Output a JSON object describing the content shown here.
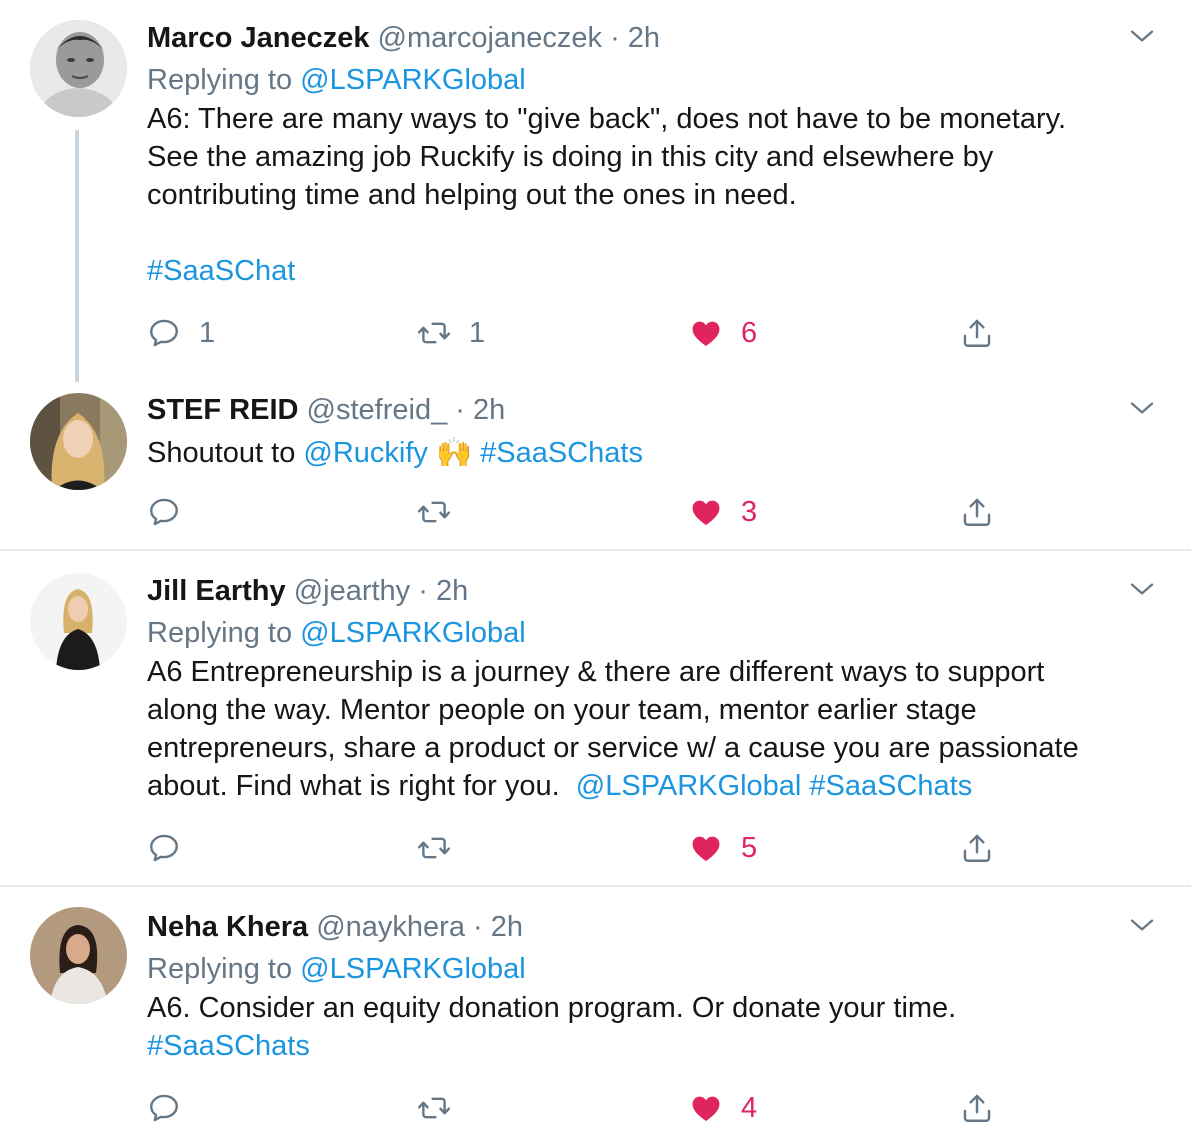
{
  "colors": {
    "link": "#1b95e0",
    "like": "#e0245e",
    "muted": "#657786",
    "text": "#14171a",
    "divider": "#e6ecf0"
  },
  "icons": {
    "reply": "reply-icon",
    "retweet": "retweet-icon",
    "like": "heart-icon",
    "share": "share-icon",
    "more": "chevron-down-icon"
  },
  "tweets": [
    {
      "name": "Marco Janeczek",
      "handle": "@marcojaneczek",
      "sep": "·",
      "time": "2h",
      "reply_prefix": "Replying to",
      "reply_to": "@LSPARKGlobal",
      "lines": [
        "A6: There are many ways to \"give back\", does not have to be monetary.",
        "See the amazing job Ruckify is doing in this city and elsewhere by",
        "contributing time and helping out the ones in need."
      ],
      "hashtag": "#SaaSChat",
      "reply_count": "1",
      "retweet_count": "1",
      "like_count": "6"
    },
    {
      "name": "STEF REID",
      "handle": "@stefreid_",
      "sep": "·",
      "time": "2h",
      "text_prefix": "Shoutout to",
      "mention": "@Ruckify",
      "emoji": "🙌",
      "hashtag": "#SaaSChats",
      "like_count": "3"
    },
    {
      "name": "Jill Earthy",
      "handle": "@jearthy",
      "sep": "·",
      "time": "2h",
      "reply_prefix": "Replying to",
      "reply_to": "@LSPARKGlobal",
      "lines": [
        "A6 Entrepreneurship is a journey & there are different ways to support",
        "along the way. Mentor people on your team, mentor earlier stage",
        "entrepreneurs, share a product or service w/ a cause you are passionate",
        "about. Find what is right for you."
      ],
      "mention": "@LSPARKGlobal",
      "hashtag": "#SaaSChats",
      "like_count": "5"
    },
    {
      "name": "Neha Khera",
      "handle": "@naykhera",
      "sep": "·",
      "time": "2h",
      "reply_prefix": "Replying to",
      "reply_to": "@LSPARKGlobal",
      "lines": [
        "A6. Consider an equity donation program. Or donate your time."
      ],
      "hashtag": "#SaaSChats",
      "like_count": "4"
    }
  ]
}
